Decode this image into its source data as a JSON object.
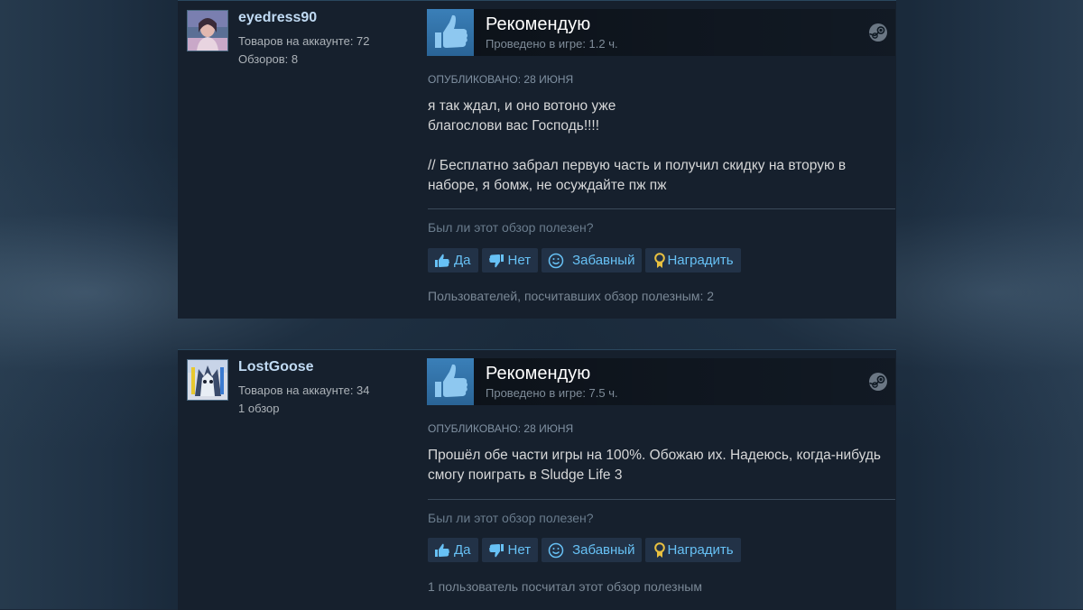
{
  "reviews": [
    {
      "author": {
        "name": "eyedress90",
        "products": "Товаров на аккаунте: 72",
        "reviews": "Обзоров: 8"
      },
      "verdict": "Рекомендую",
      "hours": "Проведено в игре: 1.2 ч.",
      "posted": "ОПУБЛИКОВАНО: 28 ИЮНЯ",
      "body": {
        "p1_line1": "я так ждал, и оно вотоно уже",
        "p1_line2": "благослови вас Господь!!!!",
        "p2": "// Бесплатно забрал первую часть и получил скидку на вторую в наборе, я бомж, не осуждайте пж пж"
      },
      "helpful_question": "Был ли этот обзор полезен?",
      "buttons": {
        "yes": "Да",
        "no": "Нет",
        "funny": "Забавный",
        "award": "Наградить"
      },
      "found_helpful": "Пользователей, посчитавших обзор полезным: 2"
    },
    {
      "author": {
        "name": "LostGoose",
        "products": "Товаров на аккаунте: 34",
        "reviews": "1 обзор"
      },
      "verdict": "Рекомендую",
      "hours": "Проведено в игре: 7.5 ч.",
      "posted": "ОПУБЛИКОВАНО: 28 ИЮНЯ",
      "body": {
        "p1": "Прошёл обе части игры на 100%. Обожаю их. Надеюсь, когда-нибудь смогу поиграть в Sludge Life 3"
      },
      "helpful_question": "Был ли этот обзор полезен?",
      "buttons": {
        "yes": "Да",
        "no": "Нет",
        "funny": "Забавный",
        "award": "Наградить"
      },
      "found_helpful": "1 пользователь посчитал этот обзор полезным"
    }
  ],
  "icons": {
    "verdict": "thumbs-up-icon",
    "platform": "steam-logo-icon",
    "yes": "thumbs-up-icon",
    "no": "thumbs-down-icon",
    "funny": "smiley-icon",
    "award": "award-ribbon-icon"
  },
  "colors": {
    "page_bg": "#1b2838",
    "review_bg": "#16202d",
    "author_name": "#c1dbf4",
    "verdict_tile": "#3a7fb8",
    "button_text": "#67c1f5",
    "button_bg": "#223247",
    "award_icon": "#e8c040"
  }
}
